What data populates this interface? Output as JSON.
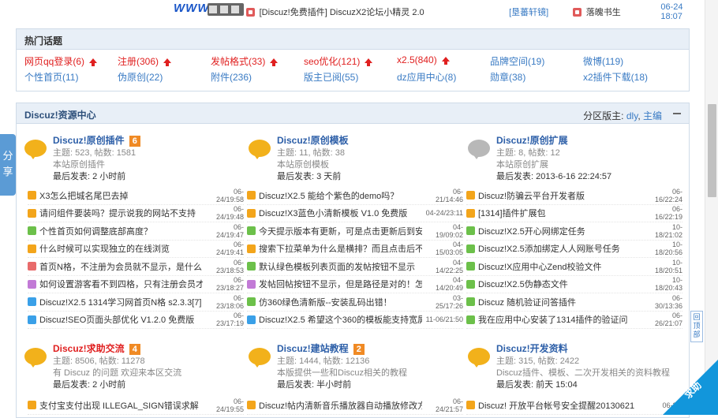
{
  "top_strip": {
    "logo_text": "WWW.131",
    "thread_title": "[Discuz!免费插件] DiscuzX2论坛小精灵 2.0",
    "forum_link": "[垦蕃轩镜]",
    "author": "落魄书生",
    "time": "06-24 18:07"
  },
  "hot_topics": {
    "title": "热门话题",
    "items": [
      {
        "label": "网页qq登录(6)",
        "hot": true
      },
      {
        "label": "注册(306)",
        "hot": true
      },
      {
        "label": "发帖格式(33)",
        "hot": true
      },
      {
        "label": "seo优化(121)",
        "hot": true
      },
      {
        "label": "x2.5(840)",
        "hot": true
      },
      {
        "label": "品牌空间(19)",
        "hot": false
      },
      {
        "label": "微博(119)",
        "hot": false
      },
      {
        "label": "个性首页(11)",
        "hot": false
      },
      {
        "label": "伪原创(22)",
        "hot": false
      },
      {
        "label": "附件(236)",
        "hot": false
      },
      {
        "label": "版主已阅(55)",
        "hot": false
      },
      {
        "label": "dz应用中心(8)",
        "hot": false
      },
      {
        "label": "勋章(38)",
        "hot": false
      },
      {
        "label": "x2插件下载(18)",
        "hot": false
      }
    ]
  },
  "resource_center": {
    "title": "Discuz!资源中心",
    "moderators_label": "分区版主:",
    "moderators": [
      "dly",
      "主编"
    ],
    "forums_row1": [
      {
        "name": "Discuz!原创插件",
        "badge": "6",
        "stat": "主题: 523, 帖数: 1581",
        "desc": "本站原创插件",
        "last": "最后发表: 2 小时前",
        "icon": "orange",
        "red": false
      },
      {
        "name": "Discuz!原创模板",
        "badge": "",
        "stat": "主题: 11, 帖数: 38",
        "desc": "本站原创模板",
        "last": "最后发表: 3 天前",
        "icon": "orange",
        "red": false
      },
      {
        "name": "Discuz!原创扩展",
        "badge": "",
        "stat": "主题: 8, 帖数: 12",
        "desc": "本站原创扩展",
        "last": "最后发表: 2013-6-16 22:24:57",
        "icon": "grey",
        "red": false
      }
    ],
    "threads_col1": [
      {
        "title": "X3怎么把城名尾巴去掉",
        "time": "06-24/19:58",
        "icon": "o"
      },
      {
        "title": "请问组件要装吗？提示说我的网站不支持",
        "time": "06-24/19:48",
        "icon": "o"
      },
      {
        "title": "个性首页如何调整底部高度？",
        "time": "06-24/19:47",
        "icon": "g"
      },
      {
        "title": "什么时候可以实现独立的在线浏览",
        "time": "06-24/19:41",
        "icon": "o"
      },
      {
        "title": "首页N格，不注册为会员就不显示，是什么",
        "time": "06-23/18:53",
        "icon": "r"
      },
      {
        "title": "如何设置游客看不到四格，只有注册会员才",
        "time": "06-23/18:27",
        "icon": "p"
      },
      {
        "title": "Discuz!X2.5 1314学习网首页N格 s2.3.3[7]",
        "time": "06-23/18:06",
        "icon": "b"
      },
      {
        "title": "Discuz!SEO页面头部优化  V1.2.0 免费版",
        "time": "06-23/17:19",
        "icon": "b"
      }
    ],
    "threads_col2": [
      {
        "title": "Discuz!X2.5 能给个紫色的demo吗？",
        "time": "06-21/14:46",
        "icon": "o"
      },
      {
        "title": "Discuz!X3蓝色小清新模板  V1.0 免费版",
        "time": "04-24/23:11",
        "icon": "o"
      },
      {
        "title": "今天提示版本有更新，可是点击更新后到安",
        "time": "04-19/09:02",
        "icon": "g"
      },
      {
        "title": "搜索下拉菜单为什么是横排？而且点击后不",
        "time": "04-15/03:05",
        "icon": "o"
      },
      {
        "title": "默认绿色模板列表页面的发帖按钮不显示",
        "time": "04-14/22:25",
        "icon": "g"
      },
      {
        "title": "发帖回帖按钮不显示，但是路径是对的！怎",
        "time": "04-14/20:49",
        "icon": "p"
      },
      {
        "title": "仿360绿色清新版--安装乱码出错！",
        "time": "03-25/17:26",
        "icon": "g"
      },
      {
        "title": "Discuz!X2.5 希望这个360的模板能支持宽屏",
        "time": "11-06/21:50",
        "icon": "b"
      }
    ],
    "threads_col3": [
      {
        "title": "Discuz!防骗云平台开发者版",
        "time": "06-16/22:24",
        "icon": "o"
      },
      {
        "title": "[1314]插件扩展包",
        "time": "06-16/22:19",
        "icon": "o"
      },
      {
        "title": "Discuz!X2.5开心网绑定任务",
        "time": "10-18/21:02",
        "icon": "g"
      },
      {
        "title": "Discuz!X2.5添加绑定人人网账号任务",
        "time": "10-18/20:56",
        "icon": "g"
      },
      {
        "title": "Discuz!X应用中心Zend校验文件",
        "time": "10-18/20:51",
        "icon": "g"
      },
      {
        "title": "Discuz!X2.5伪静态文件",
        "time": "10-18/20:43",
        "icon": "g"
      },
      {
        "title": "Discuz 随机验证问答插件",
        "time": "06-30/13:36",
        "icon": "g"
      },
      {
        "title": "我在应用中心安装了1314插件的验证问",
        "time": "06-26/21:07",
        "icon": "g"
      }
    ],
    "forums_row2": [
      {
        "name": "Discuz!求助交流",
        "badge": "4",
        "stat": "主题: 8506, 帖数: 11278",
        "desc": "有 Discuz 的问题 欢迎来本区交流",
        "last": "最后发表: 2 小时前",
        "icon": "orange",
        "red": true
      },
      {
        "name": "Discuz!建站教程",
        "badge": "2",
        "stat": "主题: 1444, 帖数: 12136",
        "desc": "本版提供一些和Discuz相关的教程",
        "last": "最后发表: 半小时前",
        "icon": "orange",
        "red": false
      },
      {
        "name": "Discuz!开发资料",
        "badge": "",
        "stat": "主题: 315, 帖数: 2422",
        "desc": "Discuz插件、模板、二次开发相关的资料教程",
        "last": "最后发表: 前天 15:04",
        "icon": "orange",
        "red": false
      }
    ],
    "threads_row2": [
      {
        "title": "支付宝支付出现 ILLEGAL_SIGN错误求解",
        "time": "06-24/19:55",
        "icon": "o"
      },
      {
        "title": "Discuz!帖内清新音乐播放器自动播放修改方",
        "time": "06-24/21:57",
        "icon": "o"
      },
      {
        "title": "Discuz! 开放平台帐号安全提醒20130621",
        "time": "06-21/",
        "icon": "o"
      }
    ]
  },
  "ui": {
    "share_tab": "分享",
    "back_to_top": "回顶部",
    "help_badge": "求助"
  }
}
